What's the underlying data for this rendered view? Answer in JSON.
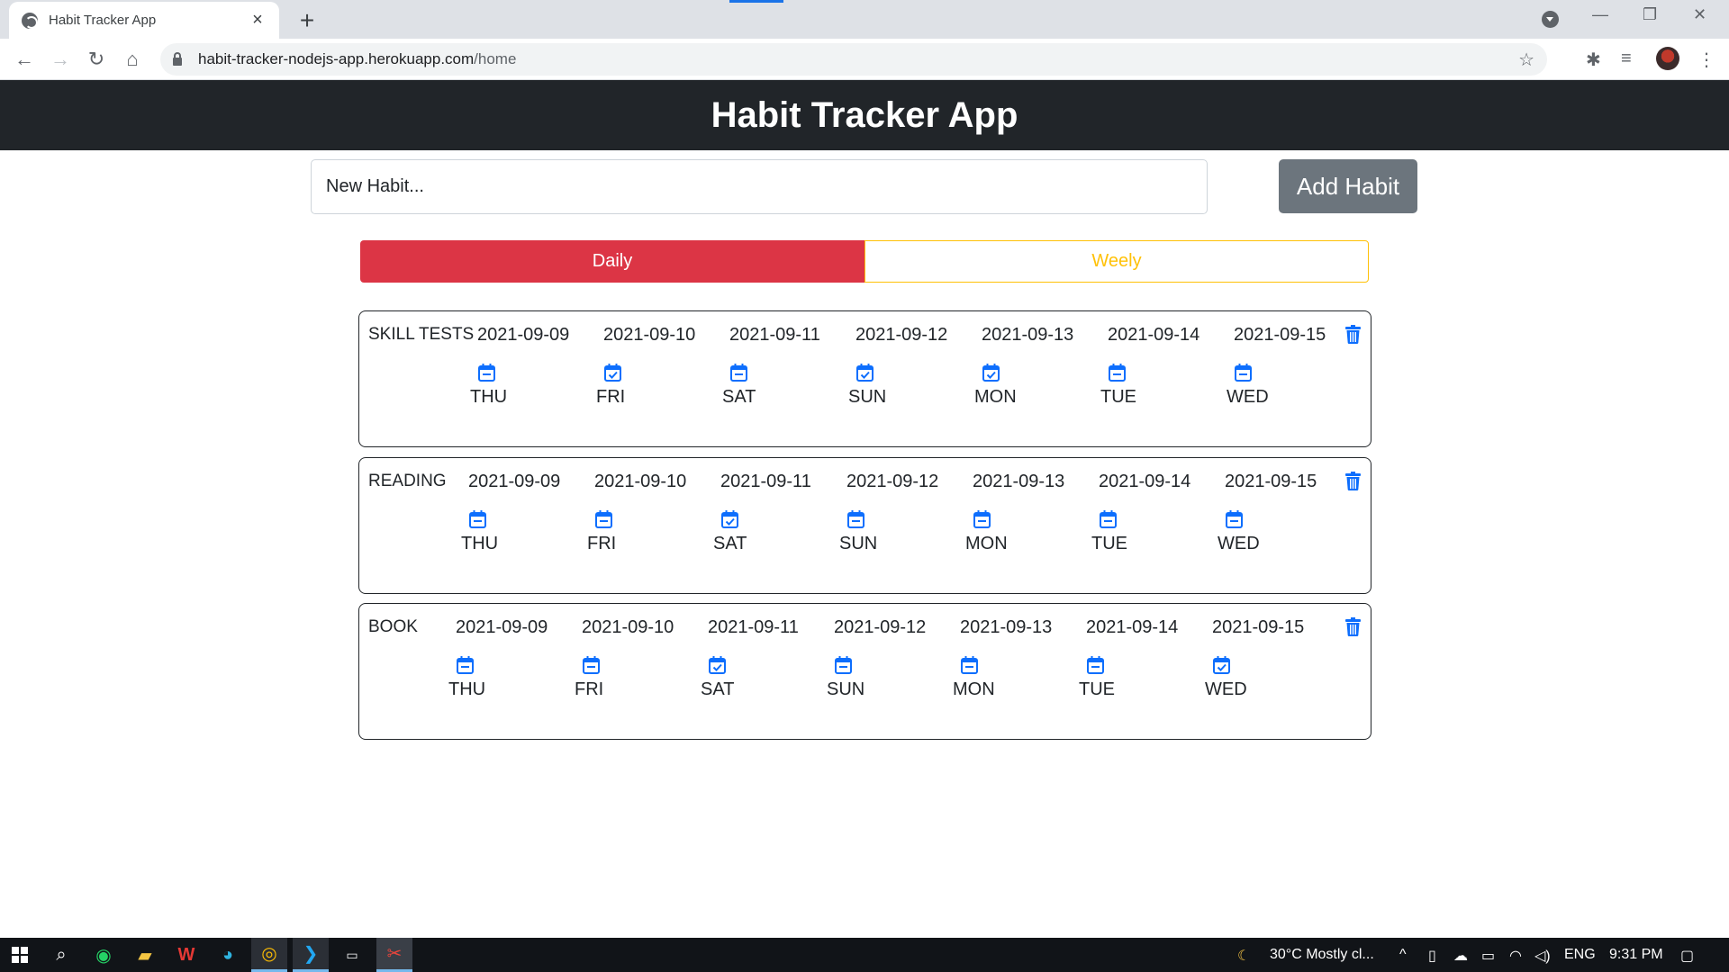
{
  "browser": {
    "tab_title": "Habit Tracker App",
    "url_host": "habit-tracker-nodejs-app.herokuapp.com",
    "url_path": "/home"
  },
  "app": {
    "title": "Habit Tracker App",
    "input_placeholder": "New Habit...",
    "add_button": "Add Habit",
    "toggle_daily": "Daily",
    "toggle_weekly": "Weely",
    "accent": "#dc3545",
    "warning": "#ffc107",
    "primary": "#0d6efd"
  },
  "habits": [
    {
      "name": "SKILL TESTS",
      "days": [
        {
          "date": "2021-09-09",
          "day": "THU",
          "done": false
        },
        {
          "date": "2021-09-10",
          "day": "FRI",
          "done": true
        },
        {
          "date": "2021-09-11",
          "day": "SAT",
          "done": false
        },
        {
          "date": "2021-09-12",
          "day": "SUN",
          "done": true
        },
        {
          "date": "2021-09-13",
          "day": "MON",
          "done": true
        },
        {
          "date": "2021-09-14",
          "day": "TUE",
          "done": false
        },
        {
          "date": "2021-09-15",
          "day": "WED",
          "done": false
        }
      ]
    },
    {
      "name": "READING",
      "days": [
        {
          "date": "2021-09-09",
          "day": "THU",
          "done": false
        },
        {
          "date": "2021-09-10",
          "day": "FRI",
          "done": false
        },
        {
          "date": "2021-09-11",
          "day": "SAT",
          "done": true
        },
        {
          "date": "2021-09-12",
          "day": "SUN",
          "done": false
        },
        {
          "date": "2021-09-13",
          "day": "MON",
          "done": false
        },
        {
          "date": "2021-09-14",
          "day": "TUE",
          "done": false
        },
        {
          "date": "2021-09-15",
          "day": "WED",
          "done": false
        }
      ]
    },
    {
      "name": "BOOK",
      "days": [
        {
          "date": "2021-09-09",
          "day": "THU",
          "done": false
        },
        {
          "date": "2021-09-10",
          "day": "FRI",
          "done": false
        },
        {
          "date": "2021-09-11",
          "day": "SAT",
          "done": true
        },
        {
          "date": "2021-09-12",
          "day": "SUN",
          "done": false
        },
        {
          "date": "2021-09-13",
          "day": "MON",
          "done": false
        },
        {
          "date": "2021-09-14",
          "day": "TUE",
          "done": false
        },
        {
          "date": "2021-09-15",
          "day": "WED",
          "done": true
        }
      ]
    }
  ],
  "taskbar": {
    "weather": "30°C  Mostly cl...",
    "language": "ENG",
    "time": "9:31 PM"
  }
}
